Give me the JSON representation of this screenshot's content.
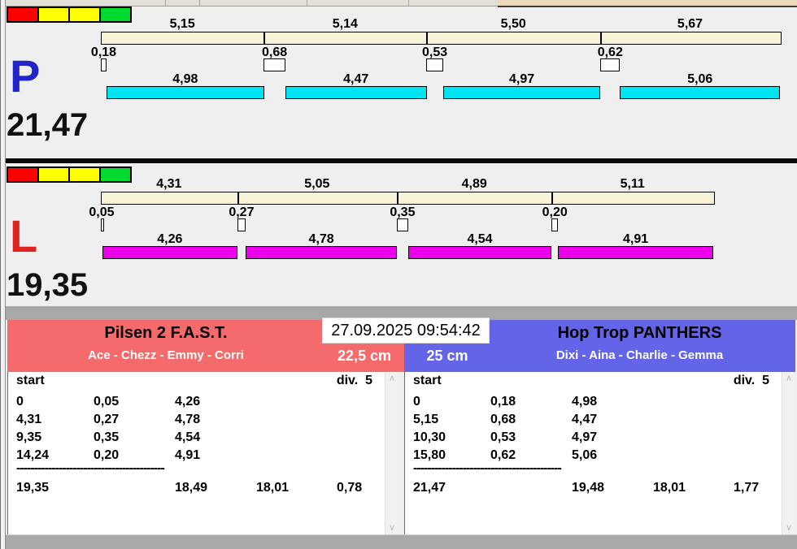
{
  "window": {
    "timestamp": "27.09.2025 09:54:42"
  },
  "icons": {
    "scroll_up": "∧",
    "scroll_down": "∨"
  },
  "traffic_light": {
    "colors": [
      "#ff0000",
      "#ffff00",
      "#ffff00",
      "#00d92e"
    ]
  },
  "lanes": [
    {
      "letter": "P",
      "letter_color": "#2323cc",
      "total": "21,47",
      "bar_color": "#00e4f2",
      "legs": [
        5.15,
        5.14,
        5.5,
        5.67
      ],
      "changes": [
        0.18,
        0.68,
        0.53,
        0.62
      ],
      "dogs": [
        4.98,
        4.47,
        4.97,
        5.06
      ]
    },
    {
      "letter": "L",
      "letter_color": "#e02222",
      "total": "19,35",
      "bar_color": "#ea00ea",
      "legs": [
        4.31,
        5.05,
        4.89,
        5.11
      ],
      "changes": [
        0.05,
        0.27,
        0.35,
        0.2
      ],
      "dogs": [
        4.26,
        4.78,
        4.54,
        4.91
      ]
    }
  ],
  "teams": [
    {
      "name": "Pilsen 2 F.A.S.T.",
      "members": "Ace - Chezz - Emmy - Corri",
      "jump_height": "22,5 cm",
      "accent": "#f56a6a",
      "table": {
        "start_label": "start",
        "div_label": "div.  5",
        "rows": [
          [
            "0",
            "0,05",
            "4,26"
          ],
          [
            "4,31",
            "0,27",
            "4,78"
          ],
          [
            "9,35",
            "0,35",
            "4,54"
          ],
          [
            "14,24",
            "0,20",
            "4,91"
          ]
        ],
        "separator": "------------------------------------------",
        "totals": [
          "19,35",
          "18,49",
          "18,01",
          "0,78"
        ]
      }
    },
    {
      "name": "Hop Trop PANTHERS",
      "members": "Dixi - Aina - Charlie - Gemma",
      "jump_height": "25 cm",
      "accent": "#6464e8",
      "table": {
        "start_label": "start",
        "div_label": "div.  5",
        "rows": [
          [
            "0",
            "0,18",
            "4,98"
          ],
          [
            "5,15",
            "0,68",
            "4,47"
          ],
          [
            "10,30",
            "0,53",
            "4,97"
          ],
          [
            "15,80",
            "0,62",
            "5,06"
          ]
        ],
        "separator": "------------------------------------------",
        "totals": [
          "21,47",
          "19,48",
          "18,01",
          "1,77"
        ]
      }
    }
  ]
}
